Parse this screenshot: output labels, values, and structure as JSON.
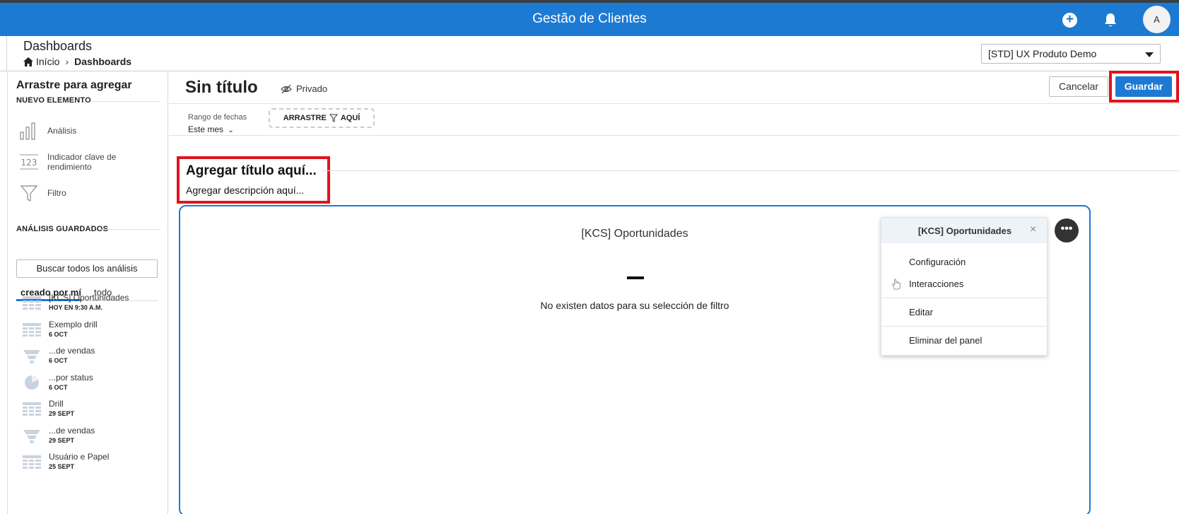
{
  "app": {
    "title": "Gestão de Clientes",
    "user_initial": "A"
  },
  "header": {
    "page_title": "Dashboards",
    "breadcrumb": {
      "home": "Início",
      "current": "Dashboards"
    },
    "workspace": "[STD] UX Produto Demo"
  },
  "sidebar": {
    "title": "Arrastre para agregar",
    "new_section": "NUEVO ELEMENTO",
    "new_items": [
      {
        "label": "Análisis",
        "icon": "bar-chart-icon"
      },
      {
        "label": "Indicador clave de rendimiento",
        "icon": "kpi-123-icon"
      },
      {
        "label": "Filtro",
        "icon": "filter-funnel-icon"
      }
    ],
    "saved_section": "ANÁLISIS GUARDADOS",
    "search_placeholder": "Buscar todos los análisis",
    "tabs": {
      "mine": "creado por mí",
      "all": "todo"
    },
    "saved_items": [
      {
        "name": "[KCS] Oportunidades",
        "date": "HOY EN 9:30 A.M.",
        "icon": "table-icon"
      },
      {
        "name": "Exemplo drill",
        "date": "6 OCT",
        "icon": "table-icon"
      },
      {
        "name": "...de vendas",
        "date": "6 OCT",
        "icon": "funnel-chart-icon"
      },
      {
        "name": "...por status",
        "date": "6 OCT",
        "icon": "pie-chart-icon"
      },
      {
        "name": "Drill",
        "date": "29 SEPT",
        "icon": "table-icon"
      },
      {
        "name": "...de vendas",
        "date": "29 SEPT",
        "icon": "funnel-chart-icon"
      },
      {
        "name": "Usuário e Papel",
        "date": "25 SEPT",
        "icon": "table-icon"
      }
    ]
  },
  "main": {
    "title": "Sin título",
    "privacy": "Privado",
    "cancel": "Cancelar",
    "save": "Guardar",
    "date_range_label": "Rango de fechas",
    "date_range_value": "Este mes",
    "drop_zone": {
      "before": "ARRASTRE",
      "after": "AQUÍ"
    },
    "section_title": "Agregar título aquí...",
    "section_desc": "Agregar descripción aquí...",
    "card": {
      "title": "[KCS] Oportunidades",
      "empty_value": "–",
      "no_data": "No existen datos para su selección de filtro"
    },
    "menu": {
      "title": "[KCS] Oportunidades",
      "items": [
        "Configuración",
        "Interacciones",
        "Editar",
        "Eliminar del panel"
      ]
    }
  },
  "colors": {
    "primary": "#1d7ad3",
    "highlight": "#e0141e",
    "menu_header": "#eef3f9"
  }
}
